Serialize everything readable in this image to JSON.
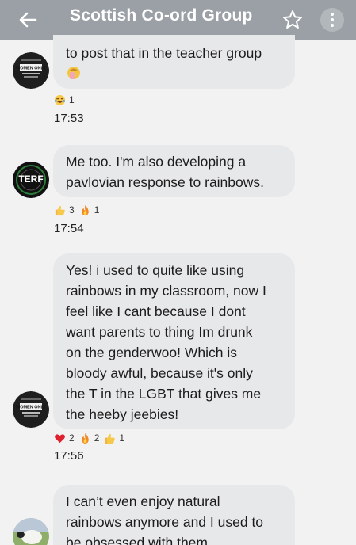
{
  "header": {
    "title": "Scottish Co‑ord Group"
  },
  "messages": [
    {
      "lines": [
        "to post that in the teacher group"
      ],
      "reactions": [
        {
          "emoji": "laughing-crying",
          "count": "1"
        }
      ],
      "time": "17:53",
      "avatar": "women-only-badge"
    },
    {
      "lines": [
        "Me too. I'm also developing a",
        "pavlovian response to rainbows."
      ],
      "reactions": [
        {
          "emoji": "thumbs-up",
          "count": "3"
        },
        {
          "emoji": "fire",
          "count": "1"
        }
      ],
      "time": "17:54",
      "avatar": "terf-badge",
      "avatar_label": "TERF"
    },
    {
      "lines": [
        "Yes! i used to quite like using",
        "rainbows in my classroom, now I",
        "feel like I cant because I dont",
        "want parents to thing Im drunk",
        "on the genderwoo! Which is",
        "bloody awful, because it's only",
        "the T in the LGBT that gives me",
        "the heeby jeebies!"
      ],
      "reactions": [
        {
          "emoji": "heart",
          "count": "2"
        },
        {
          "emoji": "fire",
          "count": "2"
        },
        {
          "emoji": "thumbs-up",
          "count": "1"
        }
      ],
      "time": "17:56",
      "avatar": "women-only-badge"
    },
    {
      "lines": [
        "I can’t even enjoy natural",
        "rainbows anymore and I used to",
        "be obsessed with them."
      ],
      "avatar": "sheep-photo"
    }
  ],
  "avatar_text": {
    "women_only": "WOMEN ONLY"
  },
  "colors": {
    "bubble": "#e7e8ea",
    "header": "#9aa0a6",
    "background": "#f2f2f2"
  }
}
